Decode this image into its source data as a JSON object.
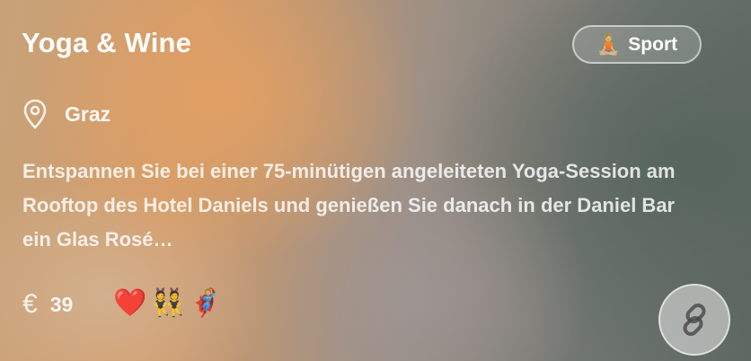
{
  "card": {
    "title": "Yoga & Wine",
    "category": {
      "emoji": "🧘🏼",
      "label": "Sport"
    },
    "location": "Graz",
    "description": "Entspannen Sie bei einer 75-minütigen angeleiteten Yoga-Session am Rooftop des Hotel Daniels und genießen Sie danach in der Daniel Bar ein Glas Rosé…",
    "price": {
      "currency": "€",
      "amount": "39"
    },
    "reactions": [
      "❤️",
      "👯",
      "🦸🏼‍♀️"
    ]
  },
  "icons": {
    "location": "location-pin-icon",
    "price": "euro-icon",
    "share": "link-icon"
  }
}
